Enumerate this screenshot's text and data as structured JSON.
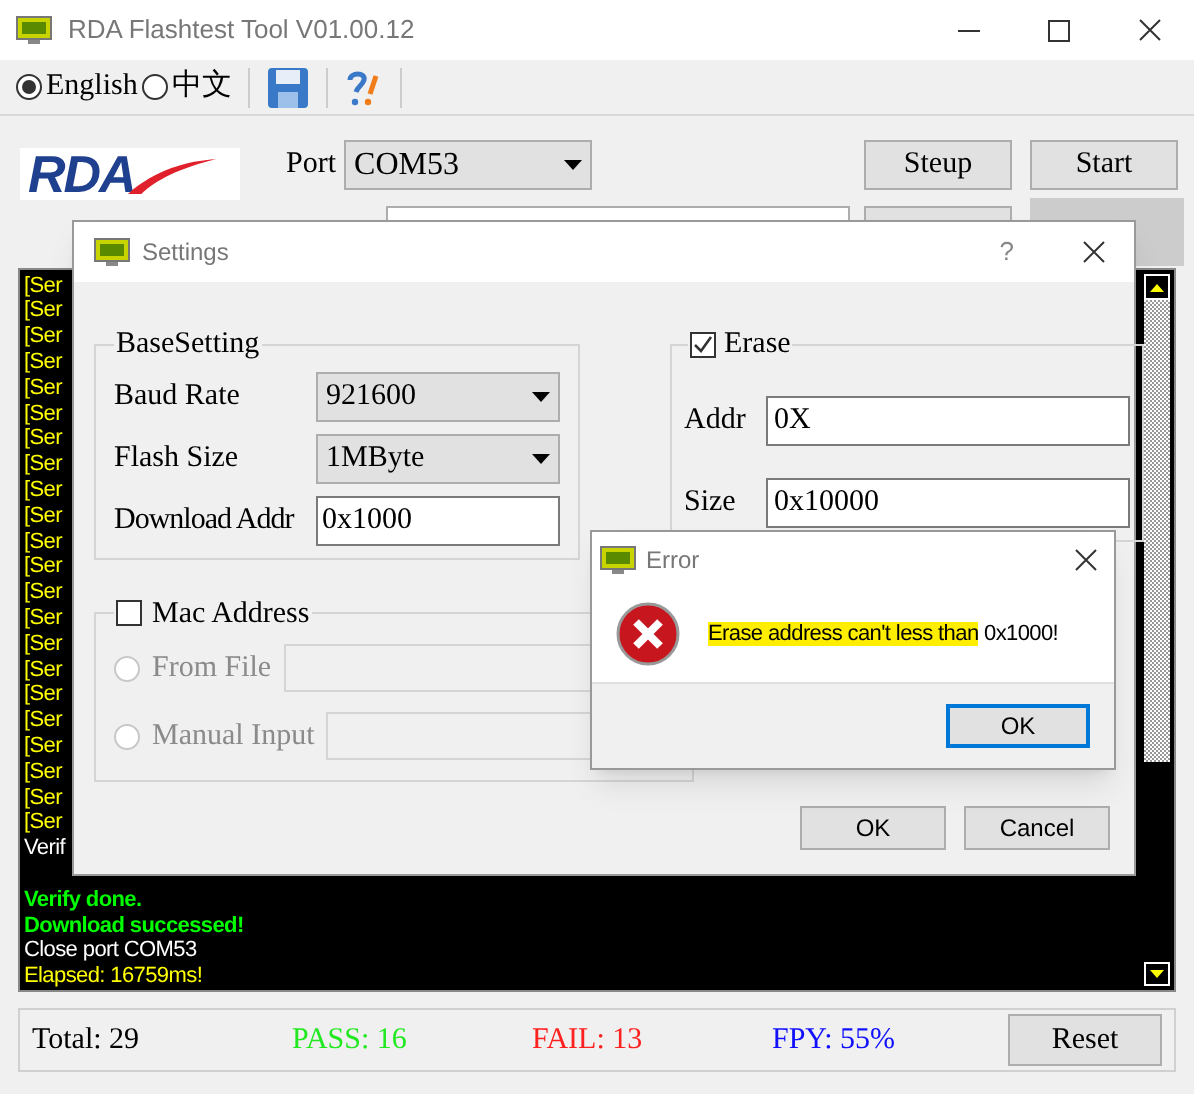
{
  "window": {
    "title": "RDA Flashtest Tool V01.00.12"
  },
  "toolbar": {
    "languages": [
      {
        "label": "English",
        "selected": true
      },
      {
        "label": "中文",
        "selected": false
      }
    ]
  },
  "header": {
    "logo_text": "RDA",
    "port_label": "Port",
    "port_value": "COM53",
    "buttons": [
      "Steup",
      "Start"
    ]
  },
  "log": {
    "lines": [
      {
        "text": "[Ser",
        "kind": "info"
      },
      {
        "text": "[Ser",
        "kind": "info"
      },
      {
        "text": "[Ser",
        "kind": "info"
      },
      {
        "text": "[Ser",
        "kind": "info"
      },
      {
        "text": "[Ser",
        "kind": "info"
      },
      {
        "text": "[Ser",
        "kind": "info"
      },
      {
        "text": "[Ser",
        "kind": "info"
      },
      {
        "text": "[Ser",
        "kind": "info"
      },
      {
        "text": "[Ser",
        "kind": "info"
      },
      {
        "text": "[Ser",
        "kind": "info"
      },
      {
        "text": "[Ser",
        "kind": "info"
      },
      {
        "text": "[Ser",
        "kind": "info"
      },
      {
        "text": "[Ser",
        "kind": "info"
      },
      {
        "text": "[Ser",
        "kind": "info"
      },
      {
        "text": "[Ser",
        "kind": "info"
      },
      {
        "text": "[Ser",
        "kind": "info"
      },
      {
        "text": "[Ser",
        "kind": "info"
      },
      {
        "text": "[Ser",
        "kind": "info"
      },
      {
        "text": "[Ser",
        "kind": "info"
      },
      {
        "text": "[Ser",
        "kind": "info"
      },
      {
        "text": "[Ser",
        "kind": "info"
      },
      {
        "text": "[Ser",
        "kind": "info"
      },
      {
        "text": "Verif",
        "kind": "plain"
      },
      {
        "text": "Verify done.",
        "kind": "success"
      },
      {
        "text": "Download successed!",
        "kind": "success"
      },
      {
        "text": "Close port COM53",
        "kind": "plain"
      },
      {
        "text": "Elapsed: 16759ms!",
        "kind": "info"
      }
    ]
  },
  "status_bar": {
    "total": "Total: 29",
    "pass": "PASS: 16",
    "fail": "FAIL: 13",
    "fpy": "FPY: 55%",
    "reset_button": "Reset"
  },
  "settings_dialog": {
    "title": "Settings",
    "help": "?",
    "base_setting": {
      "title": "BaseSetting",
      "baud_rate_label": "Baud Rate",
      "baud_rate": "921600",
      "flash_size_label": "Flash Size",
      "flash_size": "1MByte",
      "download_addr_label": "Download Addr",
      "download_addr": "0x1000"
    },
    "mac_address": {
      "label": "Mac Address",
      "checked": false,
      "options": [
        {
          "label": "From File",
          "selected": false,
          "disabled": true
        },
        {
          "label": "Manual Input",
          "selected": false,
          "disabled": true
        }
      ]
    },
    "erase": {
      "label": "Erase",
      "checked": true,
      "addr_label": "Addr",
      "addr": "0X",
      "size_label": "Size",
      "size": "0x10000"
    },
    "buttons": [
      "OK",
      "Cancel"
    ]
  },
  "error_dialog": {
    "title": "Error",
    "message_parts": [
      {
        "text": "Erase address can't less than",
        "highlighted": true
      },
      {
        "text": " 0x1000!",
        "highlighted": false
      }
    ],
    "button": "OK"
  }
}
